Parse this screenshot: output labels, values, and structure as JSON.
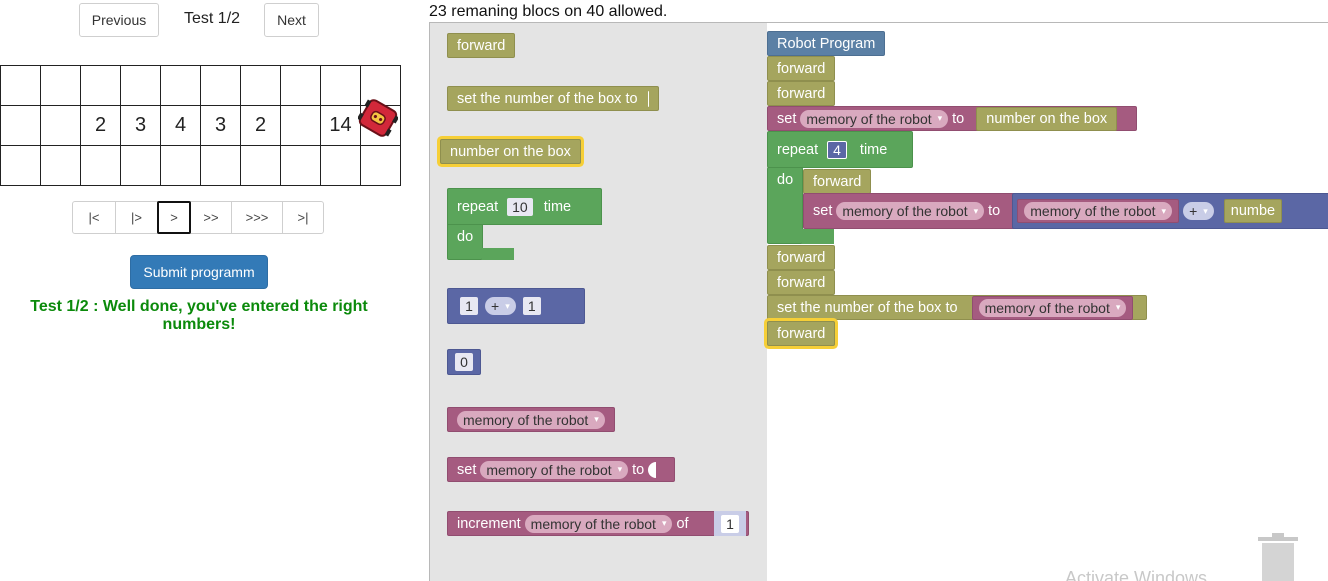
{
  "nav": {
    "previous": "Previous",
    "next": "Next",
    "test_label": "Test 1/2"
  },
  "grid": {
    "rows": [
      [
        "",
        "",
        "",
        "",
        "",
        "",
        "",
        "",
        "",
        ""
      ],
      [
        "",
        "",
        "2",
        "3",
        "4",
        "3",
        "2",
        "",
        "14",
        ""
      ],
      [
        "",
        "",
        "",
        "",
        "",
        "",
        "",
        "",
        "",
        ""
      ]
    ]
  },
  "player": {
    "buttons": [
      "|<",
      "|>",
      ">",
      ">>",
      ">>>",
      ">|"
    ],
    "active_index": 2
  },
  "submit_label": "Submit programm",
  "success_message": "Test 1/2 : Well done, you've entered the right numbers!",
  "remaining": "23 remaning blocs on 40 allowed.",
  "toolbox": {
    "forward": "forward",
    "set_number": "set the number of the box to",
    "number_on_box": "number on the box",
    "repeat": "repeat",
    "repeat_value": "10",
    "time": "time",
    "do": "do",
    "math_a": "1",
    "math_op": "+",
    "math_b": "1",
    "zero": "0",
    "memory": "memory of the robot",
    "set": "set",
    "to": "to",
    "increment": "increment",
    "of": "of",
    "increment_value": "1"
  },
  "program": {
    "header": "Robot Program",
    "forward": "forward",
    "set": "set",
    "memory": "memory of the robot",
    "to": "to",
    "number_on_box": "number on the box",
    "repeat": "repeat",
    "repeat_value": "4",
    "time": "time",
    "do": "do",
    "op": "+",
    "number_partial": "numbe",
    "set_number": "set the number of the box to"
  },
  "watermark": "Activate Windows",
  "colors": {
    "olive": "#a5a55e",
    "green": "#5ba55b",
    "indigo": "#5b67a5",
    "magenta": "#a55b80",
    "steel": "#5b80a5",
    "highlight": "#f6cf37",
    "submit": "#337ab7",
    "success": "#0b8a0b"
  }
}
